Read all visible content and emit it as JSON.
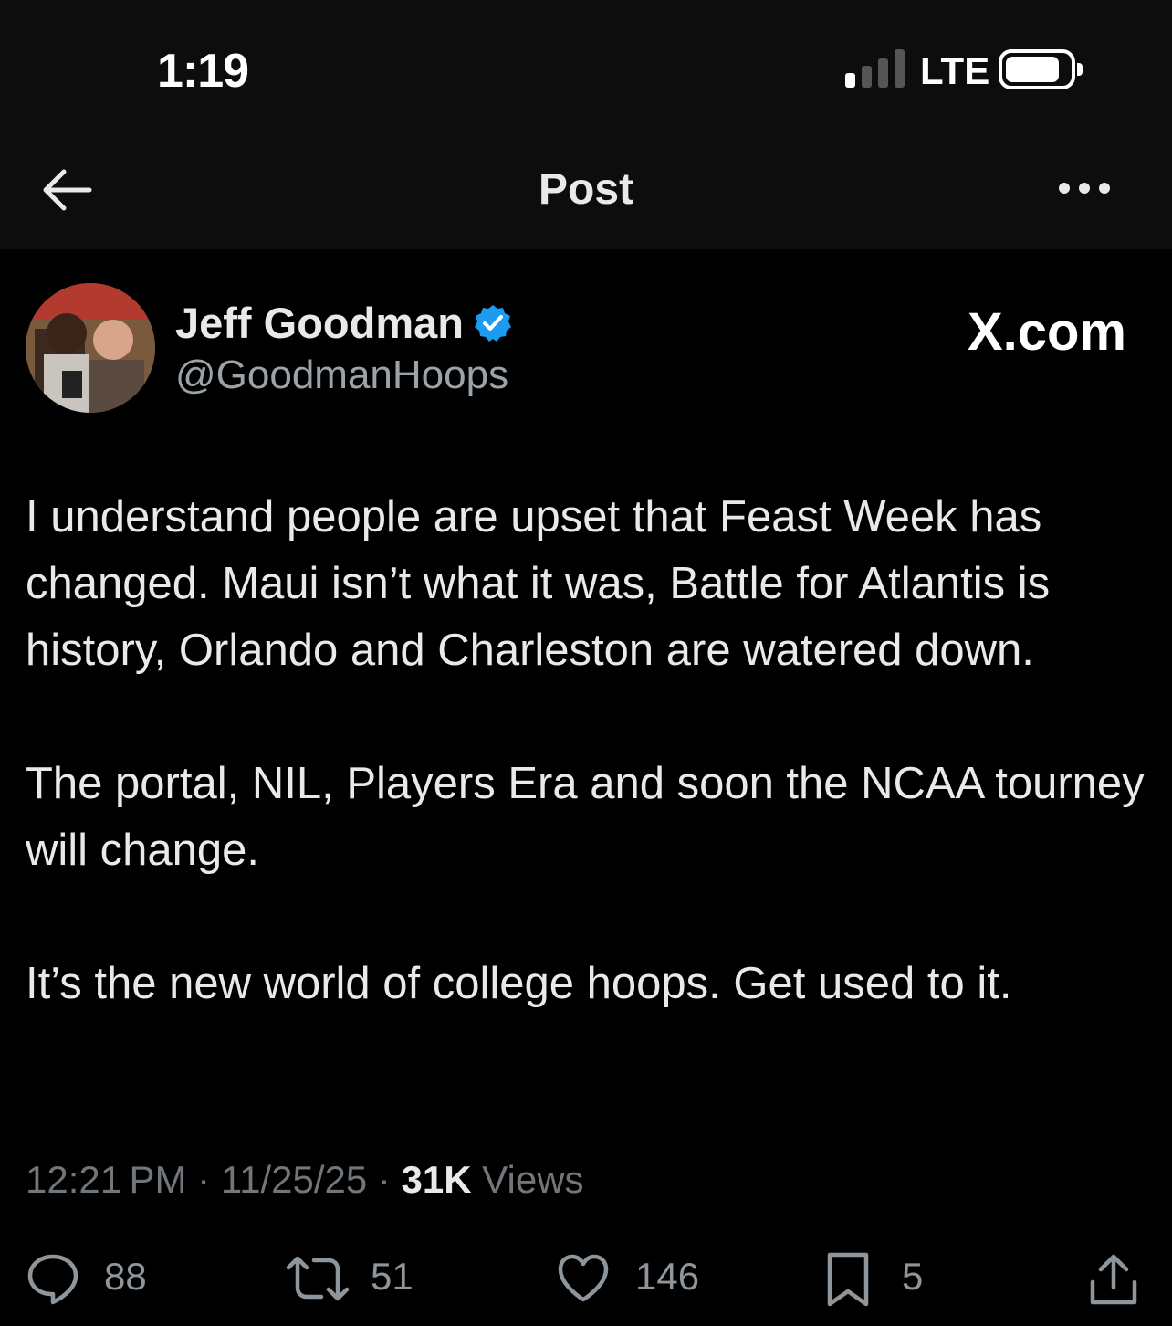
{
  "status_bar": {
    "time": "1:19",
    "network": "LTE",
    "signal_bars_active": 1,
    "signal_bars_total": 4,
    "battery_level": 0.8
  },
  "nav": {
    "title": "Post",
    "back_icon": "arrow-left-icon",
    "more_icon": "more-horizontal-icon"
  },
  "author": {
    "name": "Jeff Goodman",
    "handle": "@GoodmanHoops",
    "verified": true,
    "verified_color": "#1d9bf0"
  },
  "watermark": "X.com",
  "tweet": {
    "paragraphs": [
      "I understand people are upset that Feast Week has changed. Maui isn’t what it was, Battle for Atlantis is history, Orlando and Charleston are watered down.",
      "The portal, NIL, Players Era and soon the NCAA tourney will change.",
      "It’s the new world of college hoops. Get used to it."
    ]
  },
  "meta": {
    "time": "12:21 PM",
    "separator": " · ",
    "date": "11/25/25",
    "views_count": "31K",
    "views_label": " Views"
  },
  "actions": {
    "replies": {
      "icon": "reply-icon",
      "count": "88"
    },
    "reposts": {
      "icon": "repost-icon",
      "count": "51"
    },
    "likes": {
      "icon": "heart-icon",
      "count": "146"
    },
    "bookmarks": {
      "icon": "bookmark-icon",
      "count": "5"
    },
    "share": {
      "icon": "share-icon"
    }
  },
  "colors": {
    "background": "#000000",
    "header_background": "#0d0d0d",
    "text_primary": "#e7e9ea",
    "text_secondary": "#71767b",
    "accent": "#1d9bf0"
  }
}
